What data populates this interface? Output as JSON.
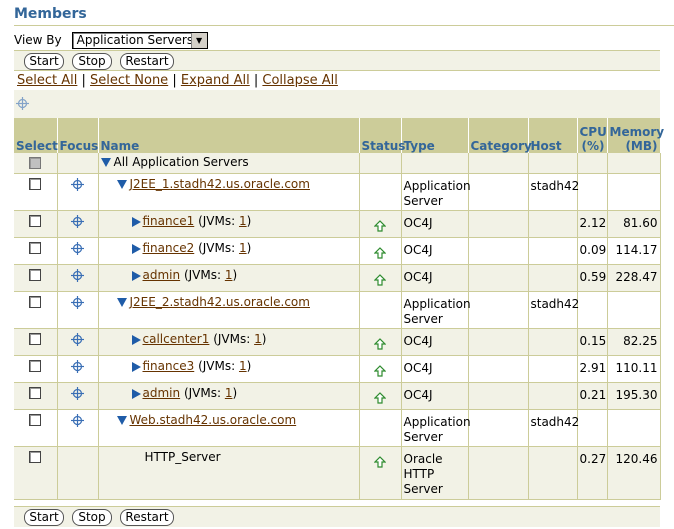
{
  "section": {
    "title": "Members"
  },
  "view_by": {
    "label": "View By",
    "selected": "Application Servers"
  },
  "buttons": {
    "start": "Start",
    "stop": "Stop",
    "restart": "Restart"
  },
  "actions": {
    "select_all": "Select All",
    "select_none": "Select None",
    "expand_all": "Expand All",
    "collapse_all": "Collapse All",
    "separator": "|"
  },
  "columns": {
    "select": "Select",
    "focus": "Focus",
    "name": "Name",
    "status": "Status",
    "type": "Type",
    "category": "Category",
    "host": "Host",
    "cpu": "CPU (%)",
    "memory": "Memory (MB)"
  },
  "root": {
    "label": "All Application Servers"
  },
  "rows": {
    "r1": {
      "name": "J2EE_1.stadh42.us.oracle.com",
      "type_l1": "Application",
      "type_l2": "Server",
      "host": "stadh42"
    },
    "r2": {
      "name": "finance1",
      "jvms_label": "(JVMs:",
      "jvms": "1",
      "type": "OC4J",
      "cpu": "2.12",
      "memory": "81.60",
      "status": "up"
    },
    "r3": {
      "name": "finance2",
      "jvms_label": "(JVMs:",
      "jvms": "1",
      "type": "OC4J",
      "cpu": "0.09",
      "memory": "114.17",
      "status": "up"
    },
    "r4": {
      "name": "admin",
      "jvms_label": "(JVMs:",
      "jvms": "1",
      "type": "OC4J",
      "cpu": "0.59",
      "memory": "228.47",
      "status": "up"
    },
    "r5": {
      "name": "J2EE_2.stadh42.us.oracle.com",
      "type_l1": "Application",
      "type_l2": "Server",
      "host": "stadh42"
    },
    "r6": {
      "name": "callcenter1",
      "jvms_label": "(JVMs:",
      "jvms": "1",
      "type": "OC4J",
      "cpu": "0.15",
      "memory": "82.25",
      "status": "up"
    },
    "r7": {
      "name": "finance3",
      "jvms_label": "(JVMs:",
      "jvms": "1",
      "type": "OC4J",
      "cpu": "2.91",
      "memory": "110.11",
      "status": "up"
    },
    "r8": {
      "name": "admin",
      "jvms_label": "(JVMs:",
      "jvms": "1",
      "type": "OC4J",
      "cpu": "0.21",
      "memory": "195.30",
      "status": "up"
    },
    "r9": {
      "name": "Web.stadh42.us.oracle.com",
      "type_l1": "Application",
      "type_l2": "Server",
      "host": "stadh42"
    },
    "r10": {
      "name": "HTTP_Server",
      "type_l1": "Oracle",
      "type_l2": "HTTP",
      "type_l3": "Server",
      "cpu": "0.27",
      "memory": "120.46",
      "status": "up"
    }
  },
  "colors": {
    "header_bg": "#cccc99",
    "header_text": "#336699",
    "link": "#663300",
    "tree_icon": "#1f5ca8",
    "status_up": "#2e8b2e"
  },
  "icons": {
    "focus": "crosshair-icon",
    "status": "up-arrow-icon",
    "expanded": "triangle-down-icon",
    "collapsed": "triangle-right-icon"
  }
}
